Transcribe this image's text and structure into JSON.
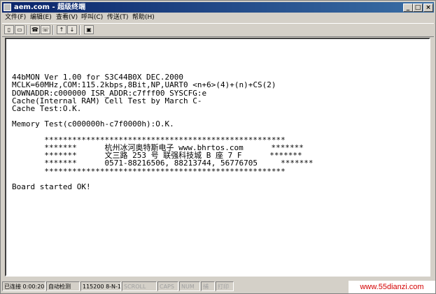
{
  "window": {
    "title": "aem.com - 超级终端"
  },
  "titlebar_buttons": {
    "minimize": "_",
    "maximize": "□",
    "close": "×"
  },
  "menu": [
    "文件(F)",
    "编辑(E)",
    "查看(V)",
    "呼叫(C)",
    "传送(T)",
    "帮助(H)"
  ],
  "toolbar": [
    "new-icon",
    "open-icon",
    "disconnect-icon",
    "connect-icon",
    "send-icon",
    "receive-icon",
    "properties-icon"
  ],
  "terminal": {
    "lines": [
      "44bMON Ver 1.00 for S3C44B0X DEC.2000",
      "MCLK=60MHz,COM:115.2kbps,8Bit,NP,UART0 <n+6>(4)+(n)+CS(2)",
      "DOWNADDR:c000000 ISR_ADDR:c7fff00 SYSCFG:e",
      "Cache(Internal RAM) Cell Test by March C-",
      "Cache Test:O.K.",
      "",
      "Memory Test(c000000h-c7f0000h):O.K.",
      "",
      "       ****************************************************",
      "       *******      杭州冰河奥特斯电子 www.bhrtos.com      *******",
      "       *******      文三路 253 号 联强科技城 B 座 7 F      *******",
      "       *******      0571-88216506, 88213744, 56776705     *******",
      "       ****************************************************",
      "",
      "Board started OK!"
    ]
  },
  "statusbar": {
    "connected": "已连接 0:00:20",
    "detect": "自动检测",
    "settings": "115200 8-N-1",
    "scroll": "SCROLL",
    "caps": "CAPS",
    "num": "NUM",
    "capture": "捕",
    "print": "打印"
  },
  "watermark": "www.55dianzi.com"
}
